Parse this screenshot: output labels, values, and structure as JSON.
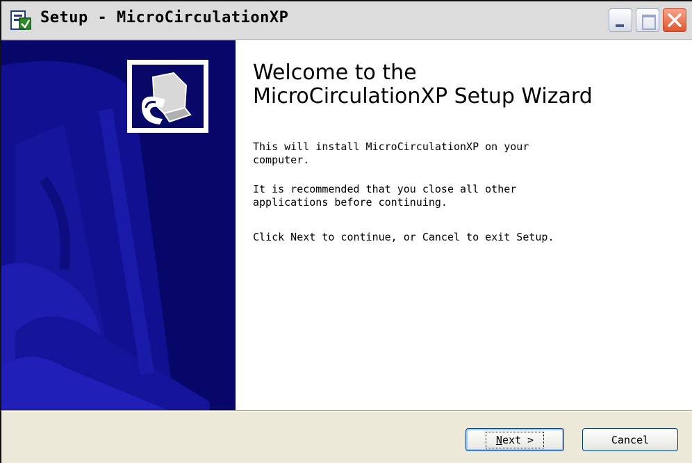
{
  "window": {
    "title": "Setup - MicroCirculationXP"
  },
  "icons": {
    "app": "setup-installer-icon",
    "minimize": "minimize-icon",
    "maximize": "maximize-icon",
    "close": "close-icon",
    "banner_logo": "computer-installer-icon"
  },
  "content": {
    "title_line1": "Welcome to the",
    "title_line2": "MicroCirculationXP Setup Wizard",
    "paragraph1_line1": "This will install MicroCirculationXP on your",
    "paragraph1_line2": "computer.",
    "paragraph2_line1": "It is recommended that you close all other",
    "paragraph2_line2": "applications before continuing.",
    "paragraph3": "Click Next to continue, or Cancel to exit Setup."
  },
  "buttons": {
    "next_mnemonic": "N",
    "next_rest": "ext >",
    "cancel": "Cancel"
  },
  "colors": {
    "banner": "#0a0a6e",
    "face": "#ece9d8",
    "close": "#e0552f"
  }
}
